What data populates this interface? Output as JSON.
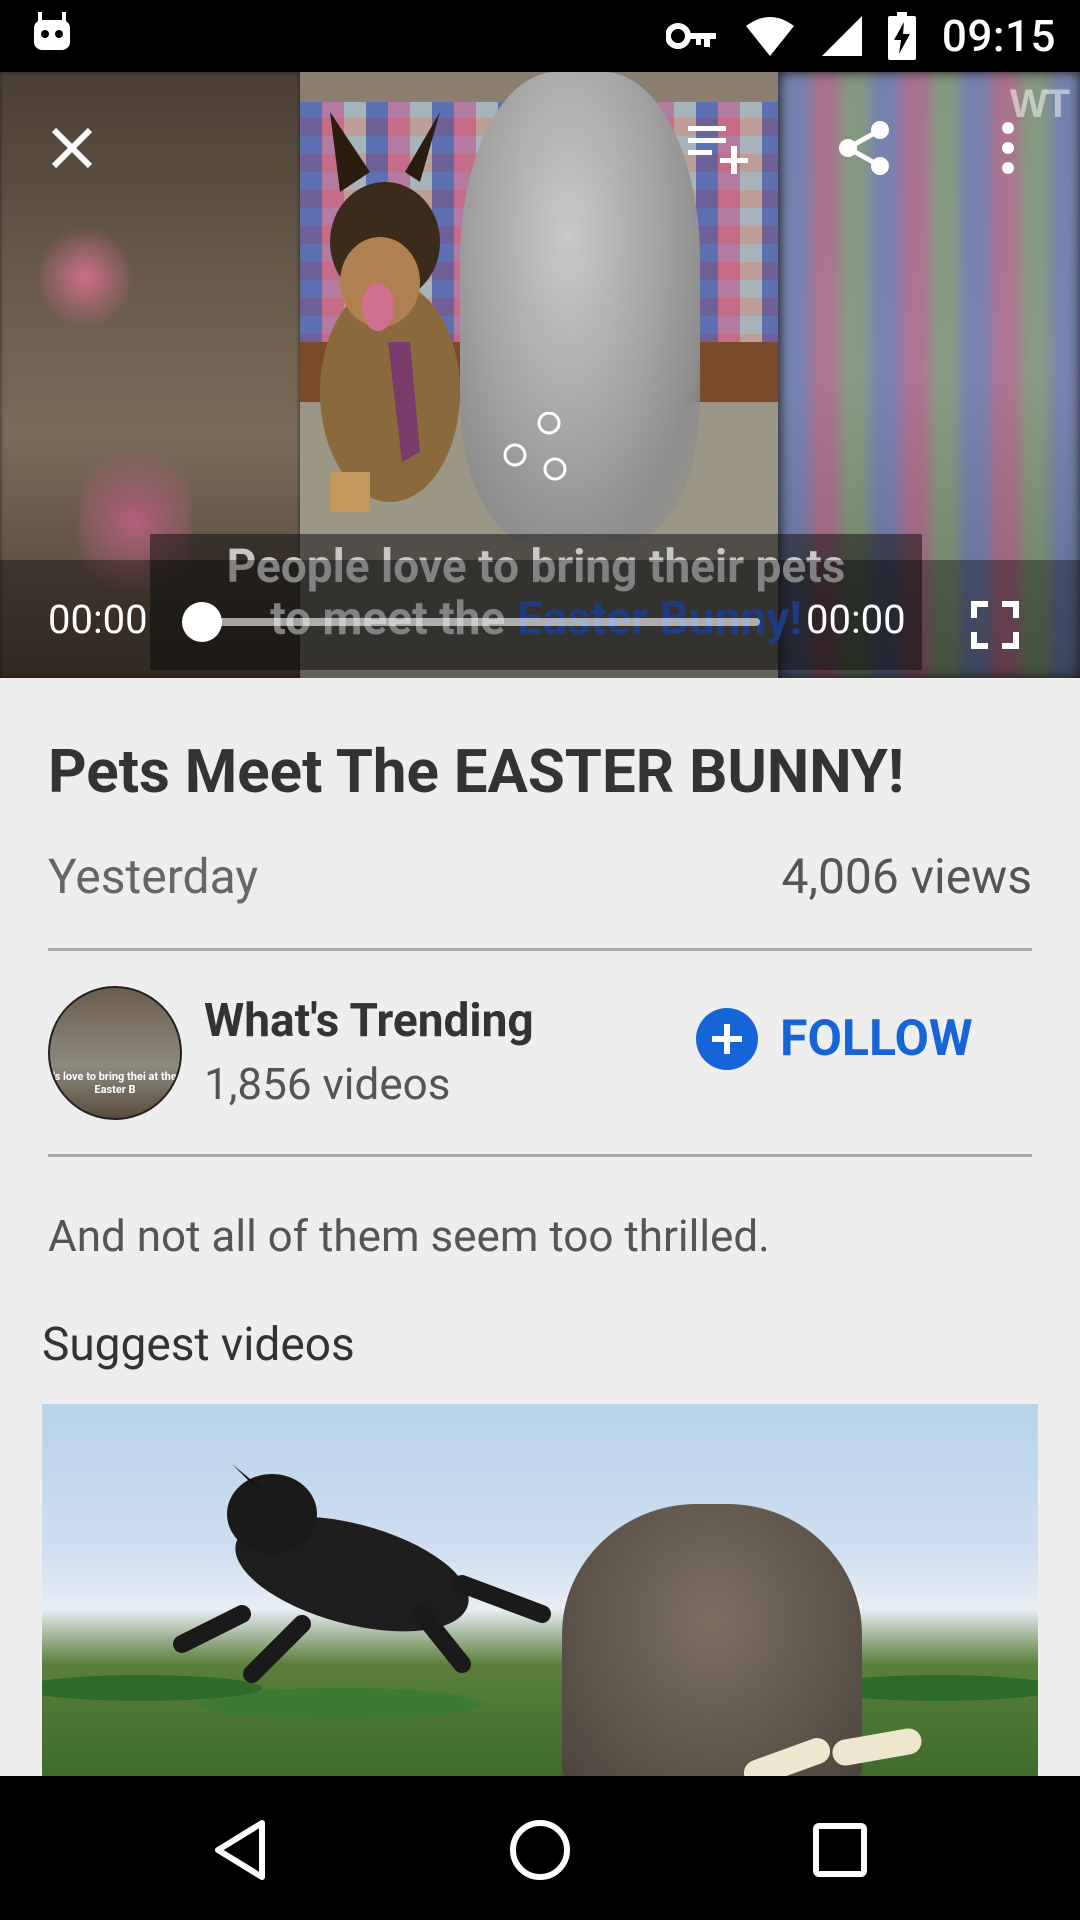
{
  "status_bar": {
    "time": "09:15",
    "icons": [
      "android-robot-icon",
      "vpn-key-icon",
      "wifi-icon",
      "cell-signal-icon",
      "battery-charging-icon"
    ]
  },
  "player": {
    "caption_line1": "People love to bring their pets",
    "caption_line2_a": "to meet the ",
    "caption_line2_b": "Easter Bunny!",
    "watermark": "WT",
    "current_time": "00:00",
    "duration": "00:00",
    "progress": 0.0,
    "icons": [
      "close-icon",
      "add-to-playlist-icon",
      "share-icon",
      "more-vert-icon",
      "fullscreen-icon"
    ]
  },
  "video": {
    "title": "Pets Meet The EASTER BUNNY!",
    "date": "Yesterday",
    "views": "4,006 views",
    "description": "And not all of them seem too thrilled."
  },
  "channel": {
    "name": "What's Trending",
    "videos": "1,856 videos",
    "avatar_text": "'s love to bring thei at the Easter B",
    "follow_label": "FOLLOW"
  },
  "suggest": {
    "section_title": "Suggest videos"
  },
  "colors": {
    "accent": "#1565d8",
    "background": "#eeeeee",
    "status_bar": "#000000"
  }
}
